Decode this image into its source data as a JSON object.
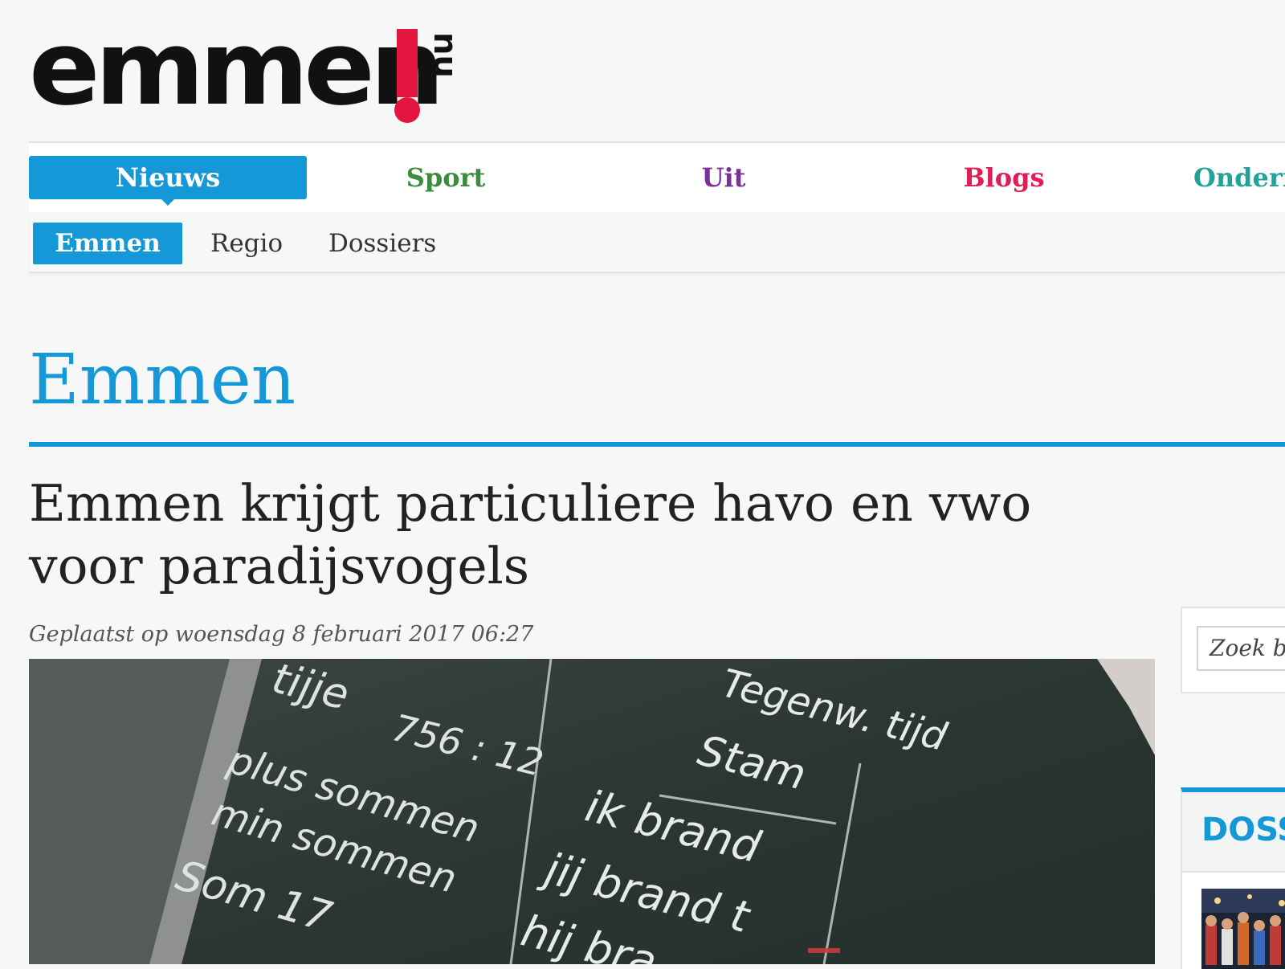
{
  "logo": {
    "word": "emmen",
    "suffix": "nu"
  },
  "main_nav": {
    "items": [
      {
        "label": "Nieuws"
      },
      {
        "label": "Sport"
      },
      {
        "label": "Uit"
      },
      {
        "label": "Blogs"
      },
      {
        "label": "Ondern"
      }
    ],
    "active": "Nieuws"
  },
  "sub_nav": {
    "items": [
      {
        "label": "Emmen"
      },
      {
        "label": "Regio"
      },
      {
        "label": "Dossiers"
      }
    ],
    "active": "Emmen"
  },
  "section": {
    "title": "Emmen"
  },
  "article": {
    "title": "Emmen krijgt particuliere havo en vwo voor paradijsvogels",
    "meta": "Geplaatst op woensdag 8 februari 2017 06:27",
    "image_text": {
      "l1": "tijje",
      "l2": "756 : 12",
      "l3": "plus sommen",
      "l4": "min sommen",
      "l5": "Som 17",
      "r1": "Tegenw. tijd",
      "r2": "Stam",
      "r3": "ik brand",
      "r4": "jij brand t",
      "r5": "hij bra"
    }
  },
  "sidebar": {
    "search_placeholder": "Zoek bi",
    "dossiers_title": "DOSS"
  },
  "colors": {
    "brand_blue": "#1598d8",
    "logo_red": "#e3163f",
    "sport_green": "#3b8c3f",
    "uit_purple": "#7b2f9a",
    "blogs_pink": "#e01d55",
    "onderneming_teal": "#21a39a"
  }
}
